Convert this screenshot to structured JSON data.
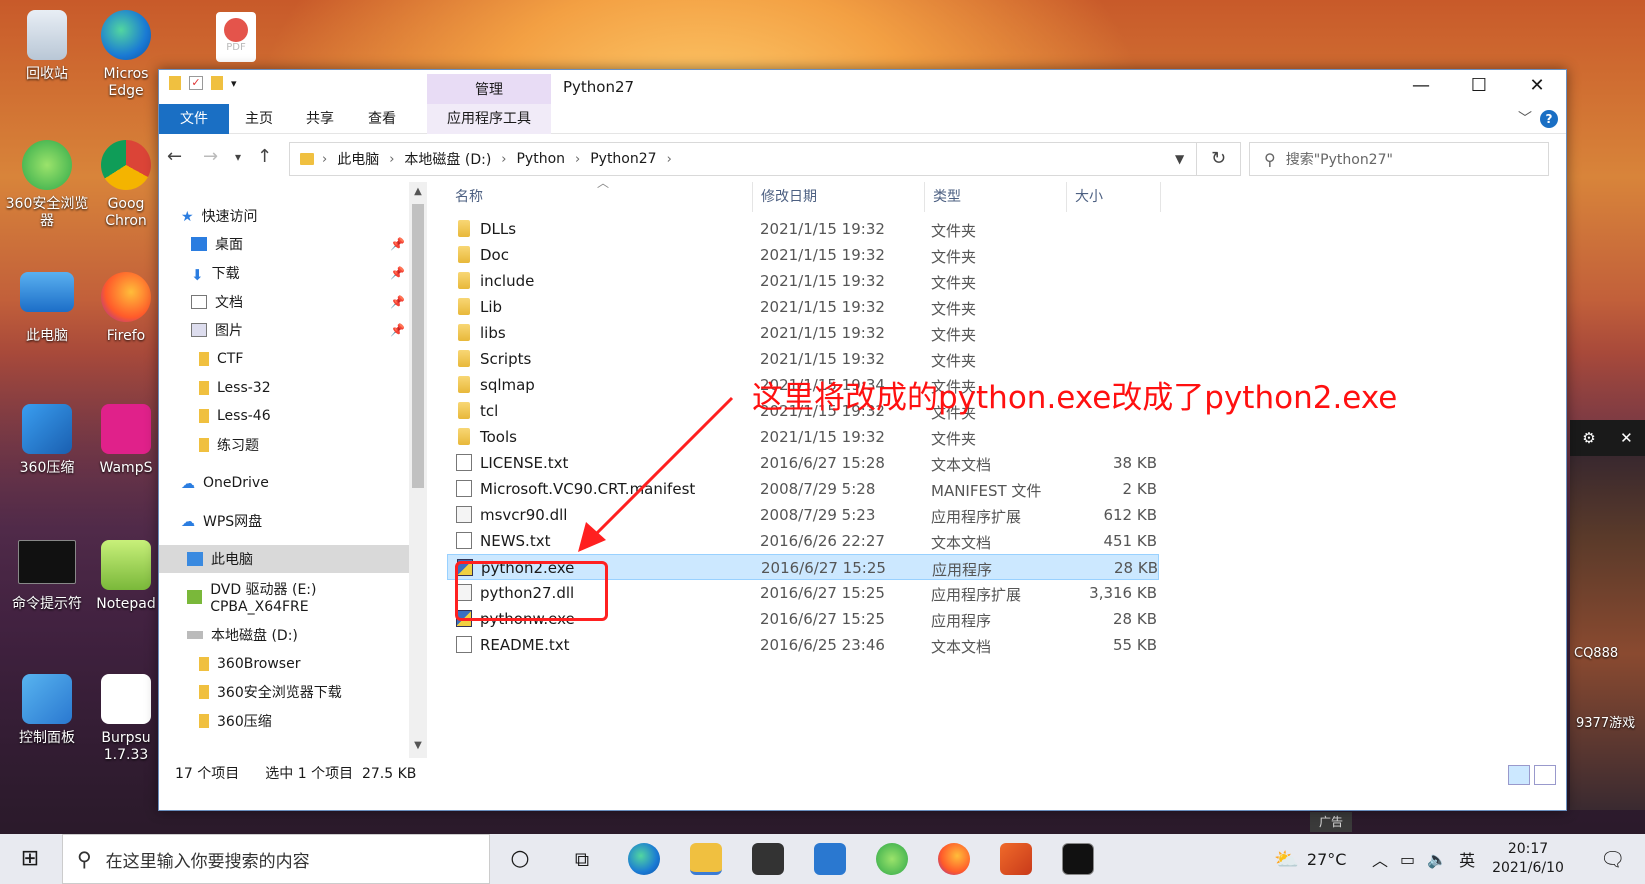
{
  "desktop": {
    "icons": [
      {
        "label": "回收站"
      },
      {
        "label": "Micros Edge"
      },
      {
        "label": "360安全浏览器"
      },
      {
        "label": "Goog Chron"
      },
      {
        "label": "此电脑"
      },
      {
        "label": "Firefo"
      },
      {
        "label": "360压缩"
      },
      {
        "label": "WampS"
      },
      {
        "label": "命令提示符"
      },
      {
        "label": "Notepad"
      },
      {
        "label": "控制面板"
      },
      {
        "label": "Burpsu 1.7.33"
      }
    ],
    "game_labels": [
      "CQ888",
      "9377游戏"
    ],
    "ad_label": "广告"
  },
  "window": {
    "title": "Python27",
    "manage_tab": "管理",
    "ribbon_tabs": [
      "文件",
      "主页",
      "共享",
      "查看",
      "应用程序工具"
    ],
    "help": "?",
    "breadcrumbs": [
      "此电脑",
      "本地磁盘 (D:)",
      "Python",
      "Python27"
    ],
    "search_placeholder": "搜索\"Python27\""
  },
  "nav": {
    "items": [
      {
        "label": "快速访问",
        "pinned": false
      },
      {
        "label": "桌面",
        "pinned": true
      },
      {
        "label": "下载",
        "pinned": true
      },
      {
        "label": "文档",
        "pinned": true
      },
      {
        "label": "图片",
        "pinned": true
      },
      {
        "label": "CTF",
        "pinned": false
      },
      {
        "label": "Less-32",
        "pinned": false
      },
      {
        "label": "Less-46",
        "pinned": false
      },
      {
        "label": "练习题",
        "pinned": false
      },
      {
        "label": "OneDrive",
        "pinned": false
      },
      {
        "label": "WPS网盘",
        "pinned": false
      },
      {
        "label": "此电脑",
        "pinned": false
      },
      {
        "label": "DVD 驱动器 (E:) CPBA_X64FRE",
        "pinned": false
      },
      {
        "label": "本地磁盘 (D:)",
        "pinned": false
      },
      {
        "label": "360Browser",
        "pinned": false
      },
      {
        "label": "360安全浏览器下载",
        "pinned": false
      },
      {
        "label": "360压缩",
        "pinned": false
      }
    ]
  },
  "list": {
    "columns": [
      "名称",
      "修改日期",
      "类型",
      "大小"
    ],
    "rows": [
      {
        "name": "DLLs",
        "date": "2021/1/15 19:32",
        "type": "文件夹",
        "size": "",
        "kind": "folder"
      },
      {
        "name": "Doc",
        "date": "2021/1/15 19:32",
        "type": "文件夹",
        "size": "",
        "kind": "folder"
      },
      {
        "name": "include",
        "date": "2021/1/15 19:32",
        "type": "文件夹",
        "size": "",
        "kind": "folder"
      },
      {
        "name": "Lib",
        "date": "2021/1/15 19:32",
        "type": "文件夹",
        "size": "",
        "kind": "folder"
      },
      {
        "name": "libs",
        "date": "2021/1/15 19:32",
        "type": "文件夹",
        "size": "",
        "kind": "folder"
      },
      {
        "name": "Scripts",
        "date": "2021/1/15 19:32",
        "type": "文件夹",
        "size": "",
        "kind": "folder"
      },
      {
        "name": "sqlmap",
        "date": "2021/1/15 19:34",
        "type": "文件夹",
        "size": "",
        "kind": "folder"
      },
      {
        "name": "tcl",
        "date": "2021/1/15 19:32",
        "type": "文件夹",
        "size": "",
        "kind": "folder"
      },
      {
        "name": "Tools",
        "date": "2021/1/15 19:32",
        "type": "文件夹",
        "size": "",
        "kind": "folder"
      },
      {
        "name": "LICENSE.txt",
        "date": "2016/6/27 15:28",
        "type": "文本文档",
        "size": "38 KB",
        "kind": "txt"
      },
      {
        "name": "Microsoft.VC90.CRT.manifest",
        "date": "2008/7/29 5:28",
        "type": "MANIFEST 文件",
        "size": "2 KB",
        "kind": "txt"
      },
      {
        "name": "msvcr90.dll",
        "date": "2008/7/29 5:23",
        "type": "应用程序扩展",
        "size": "612 KB",
        "kind": "dll"
      },
      {
        "name": "NEWS.txt",
        "date": "2016/6/26 22:27",
        "type": "文本文档",
        "size": "451 KB",
        "kind": "txt"
      },
      {
        "name": "python2.exe",
        "date": "2016/6/27 15:25",
        "type": "应用程序",
        "size": "28 KB",
        "kind": "exe",
        "selected": true
      },
      {
        "name": "python27.dll",
        "date": "2016/6/27 15:25",
        "type": "应用程序扩展",
        "size": "3,316 KB",
        "kind": "dll"
      },
      {
        "name": "pythonw.exe",
        "date": "2016/6/27 15:25",
        "type": "应用程序",
        "size": "28 KB",
        "kind": "exe"
      },
      {
        "name": "README.txt",
        "date": "2016/6/25 23:46",
        "type": "文本文档",
        "size": "55 KB",
        "kind": "txt"
      }
    ]
  },
  "status": {
    "count": "17 个项目",
    "selection": "选中 1 个项目",
    "selection_size": "27.5 KB"
  },
  "annotation": {
    "text": "这里将改成的python.exe改成了python2.exe",
    "color": "#ff1010"
  },
  "taskbar": {
    "search_placeholder": "在这里输入你要搜索的内容",
    "temperature": "27°C",
    "ime": "英",
    "time": "20:17",
    "date": "2021/6/10"
  }
}
